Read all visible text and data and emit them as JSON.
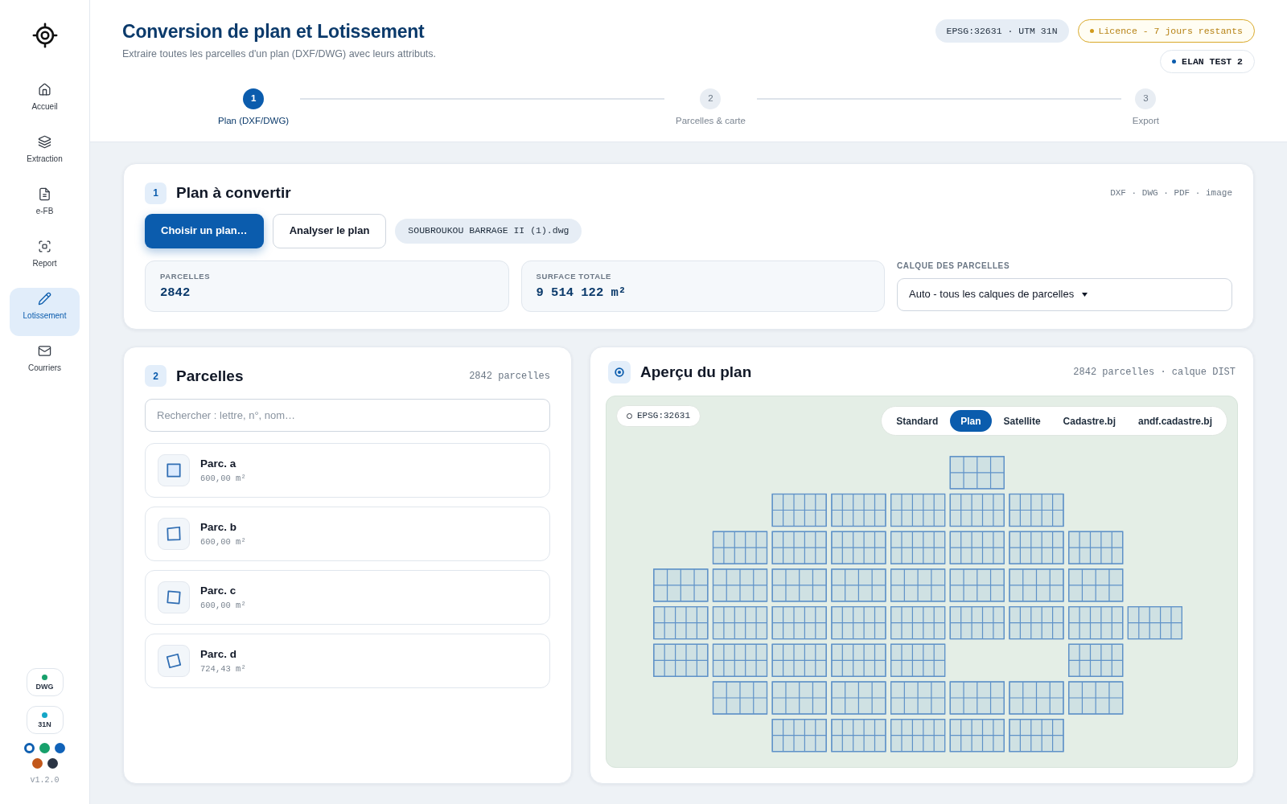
{
  "sidebar": {
    "nav": [
      {
        "label": "Accueil",
        "selected": false
      },
      {
        "label": "Extraction",
        "selected": false
      },
      {
        "label": "e-FB",
        "selected": false
      },
      {
        "label": "Report",
        "selected": false
      },
      {
        "label": "Lotissement",
        "selected": true
      },
      {
        "label": "Courriers",
        "selected": false
      }
    ],
    "status": [
      {
        "label": "DWG",
        "color": "#17a06b"
      },
      {
        "label": "31N",
        "color": "#14a6c7"
      }
    ],
    "swatches": [
      {
        "color": "#0f5fb0",
        "selected": true
      },
      {
        "color": "#17a06b",
        "selected": false
      },
      {
        "color": "#1062b8",
        "selected": false
      },
      {
        "color": "#c2571a",
        "selected": false
      },
      {
        "color": "#2a3444",
        "selected": false
      }
    ],
    "version": "v1.2.0"
  },
  "header": {
    "title": "Conversion de plan et Lotissement",
    "subtitle": "Extraire toutes les parcelles d'un plan (DXF/DWG) avec leurs attributs.",
    "crs_badge": "EPSG:32631 · UTM 31N",
    "license_badge": "Licence - 7 jours restants",
    "user_badge": "ELAN TEST 2",
    "steps": [
      {
        "number": "1",
        "label": "Plan (DXF/DWG)",
        "selected": true
      },
      {
        "number": "2",
        "label": "Parcelles & carte",
        "selected": false
      },
      {
        "number": "3",
        "label": "Export",
        "selected": false
      }
    ]
  },
  "plan_card": {
    "number": "1",
    "title": "Plan à convertir",
    "formats": "DXF · DWG · PDF · image",
    "buttons": [
      {
        "label": "Choisir un plan…",
        "kind": "primary"
      },
      {
        "label": "Analyser le plan",
        "kind": "secondary"
      }
    ],
    "file_name": "SOUBROUKOU BARRAGE II (1).dwg",
    "stats": [
      {
        "label": "PARCELLES",
        "value": "2842"
      },
      {
        "label": "SURFACE TOTALE",
        "value": "9 514 122 m²"
      }
    ],
    "layer_select": {
      "label": "CALQUE DES PARCELLES",
      "value": "Auto - tous les calques de parcelles"
    }
  },
  "parcels_card": {
    "number": "2",
    "title": "Parcelles",
    "count": "2842 parcelles",
    "search": {
      "placeholder": "Rechercher : lettre, n°, nom…"
    },
    "items": [
      {
        "name": "Parc. a",
        "area": "600,00 m²",
        "selected": true
      },
      {
        "name": "Parc. b",
        "area": "600,00 m²",
        "selected": false
      },
      {
        "name": "Parc. c",
        "area": "600,00 m²",
        "selected": false
      },
      {
        "name": "Parc. d",
        "area": "724,43 m²",
        "selected": false
      }
    ]
  },
  "preview_card": {
    "title": "Aperçu du plan",
    "summary": "2842 parcelles · calque DIST",
    "crs": "EPSG:32631",
    "basemaps": [
      {
        "label": "Standard",
        "selected": false
      },
      {
        "label": "Plan",
        "selected": true
      },
      {
        "label": "Satellite",
        "selected": false
      },
      {
        "label": "Cadastre.bj",
        "selected": false
      },
      {
        "label": "andf.cadastre.bj",
        "selected": false
      }
    ]
  }
}
